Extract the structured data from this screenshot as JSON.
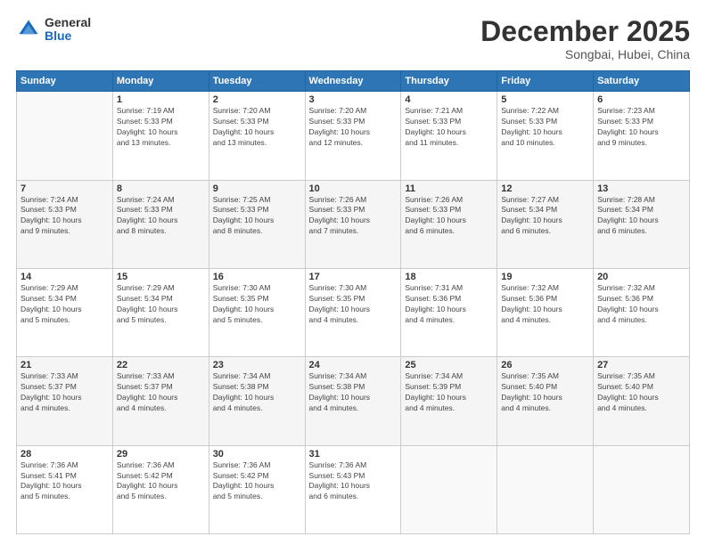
{
  "logo": {
    "general": "General",
    "blue": "Blue"
  },
  "header": {
    "month": "December 2025",
    "location": "Songbai, Hubei, China"
  },
  "days_of_week": [
    "Sunday",
    "Monday",
    "Tuesday",
    "Wednesday",
    "Thursday",
    "Friday",
    "Saturday"
  ],
  "weeks": [
    [
      {
        "day": "",
        "info": ""
      },
      {
        "day": "1",
        "info": "Sunrise: 7:19 AM\nSunset: 5:33 PM\nDaylight: 10 hours\nand 13 minutes."
      },
      {
        "day": "2",
        "info": "Sunrise: 7:20 AM\nSunset: 5:33 PM\nDaylight: 10 hours\nand 13 minutes."
      },
      {
        "day": "3",
        "info": "Sunrise: 7:20 AM\nSunset: 5:33 PM\nDaylight: 10 hours\nand 12 minutes."
      },
      {
        "day": "4",
        "info": "Sunrise: 7:21 AM\nSunset: 5:33 PM\nDaylight: 10 hours\nand 11 minutes."
      },
      {
        "day": "5",
        "info": "Sunrise: 7:22 AM\nSunset: 5:33 PM\nDaylight: 10 hours\nand 10 minutes."
      },
      {
        "day": "6",
        "info": "Sunrise: 7:23 AM\nSunset: 5:33 PM\nDaylight: 10 hours\nand 9 minutes."
      }
    ],
    [
      {
        "day": "7",
        "info": "Sunrise: 7:24 AM\nSunset: 5:33 PM\nDaylight: 10 hours\nand 9 minutes."
      },
      {
        "day": "8",
        "info": "Sunrise: 7:24 AM\nSunset: 5:33 PM\nDaylight: 10 hours\nand 8 minutes."
      },
      {
        "day": "9",
        "info": "Sunrise: 7:25 AM\nSunset: 5:33 PM\nDaylight: 10 hours\nand 8 minutes."
      },
      {
        "day": "10",
        "info": "Sunrise: 7:26 AM\nSunset: 5:33 PM\nDaylight: 10 hours\nand 7 minutes."
      },
      {
        "day": "11",
        "info": "Sunrise: 7:26 AM\nSunset: 5:33 PM\nDaylight: 10 hours\nand 6 minutes."
      },
      {
        "day": "12",
        "info": "Sunrise: 7:27 AM\nSunset: 5:34 PM\nDaylight: 10 hours\nand 6 minutes."
      },
      {
        "day": "13",
        "info": "Sunrise: 7:28 AM\nSunset: 5:34 PM\nDaylight: 10 hours\nand 6 minutes."
      }
    ],
    [
      {
        "day": "14",
        "info": "Sunrise: 7:29 AM\nSunset: 5:34 PM\nDaylight: 10 hours\nand 5 minutes."
      },
      {
        "day": "15",
        "info": "Sunrise: 7:29 AM\nSunset: 5:34 PM\nDaylight: 10 hours\nand 5 minutes."
      },
      {
        "day": "16",
        "info": "Sunrise: 7:30 AM\nSunset: 5:35 PM\nDaylight: 10 hours\nand 5 minutes."
      },
      {
        "day": "17",
        "info": "Sunrise: 7:30 AM\nSunset: 5:35 PM\nDaylight: 10 hours\nand 4 minutes."
      },
      {
        "day": "18",
        "info": "Sunrise: 7:31 AM\nSunset: 5:36 PM\nDaylight: 10 hours\nand 4 minutes."
      },
      {
        "day": "19",
        "info": "Sunrise: 7:32 AM\nSunset: 5:36 PM\nDaylight: 10 hours\nand 4 minutes."
      },
      {
        "day": "20",
        "info": "Sunrise: 7:32 AM\nSunset: 5:36 PM\nDaylight: 10 hours\nand 4 minutes."
      }
    ],
    [
      {
        "day": "21",
        "info": "Sunrise: 7:33 AM\nSunset: 5:37 PM\nDaylight: 10 hours\nand 4 minutes."
      },
      {
        "day": "22",
        "info": "Sunrise: 7:33 AM\nSunset: 5:37 PM\nDaylight: 10 hours\nand 4 minutes."
      },
      {
        "day": "23",
        "info": "Sunrise: 7:34 AM\nSunset: 5:38 PM\nDaylight: 10 hours\nand 4 minutes."
      },
      {
        "day": "24",
        "info": "Sunrise: 7:34 AM\nSunset: 5:38 PM\nDaylight: 10 hours\nand 4 minutes."
      },
      {
        "day": "25",
        "info": "Sunrise: 7:34 AM\nSunset: 5:39 PM\nDaylight: 10 hours\nand 4 minutes."
      },
      {
        "day": "26",
        "info": "Sunrise: 7:35 AM\nSunset: 5:40 PM\nDaylight: 10 hours\nand 4 minutes."
      },
      {
        "day": "27",
        "info": "Sunrise: 7:35 AM\nSunset: 5:40 PM\nDaylight: 10 hours\nand 4 minutes."
      }
    ],
    [
      {
        "day": "28",
        "info": "Sunrise: 7:36 AM\nSunset: 5:41 PM\nDaylight: 10 hours\nand 5 minutes."
      },
      {
        "day": "29",
        "info": "Sunrise: 7:36 AM\nSunset: 5:42 PM\nDaylight: 10 hours\nand 5 minutes."
      },
      {
        "day": "30",
        "info": "Sunrise: 7:36 AM\nSunset: 5:42 PM\nDaylight: 10 hours\nand 5 minutes."
      },
      {
        "day": "31",
        "info": "Sunrise: 7:36 AM\nSunset: 5:43 PM\nDaylight: 10 hours\nand 6 minutes."
      },
      {
        "day": "",
        "info": ""
      },
      {
        "day": "",
        "info": ""
      },
      {
        "day": "",
        "info": ""
      }
    ]
  ]
}
